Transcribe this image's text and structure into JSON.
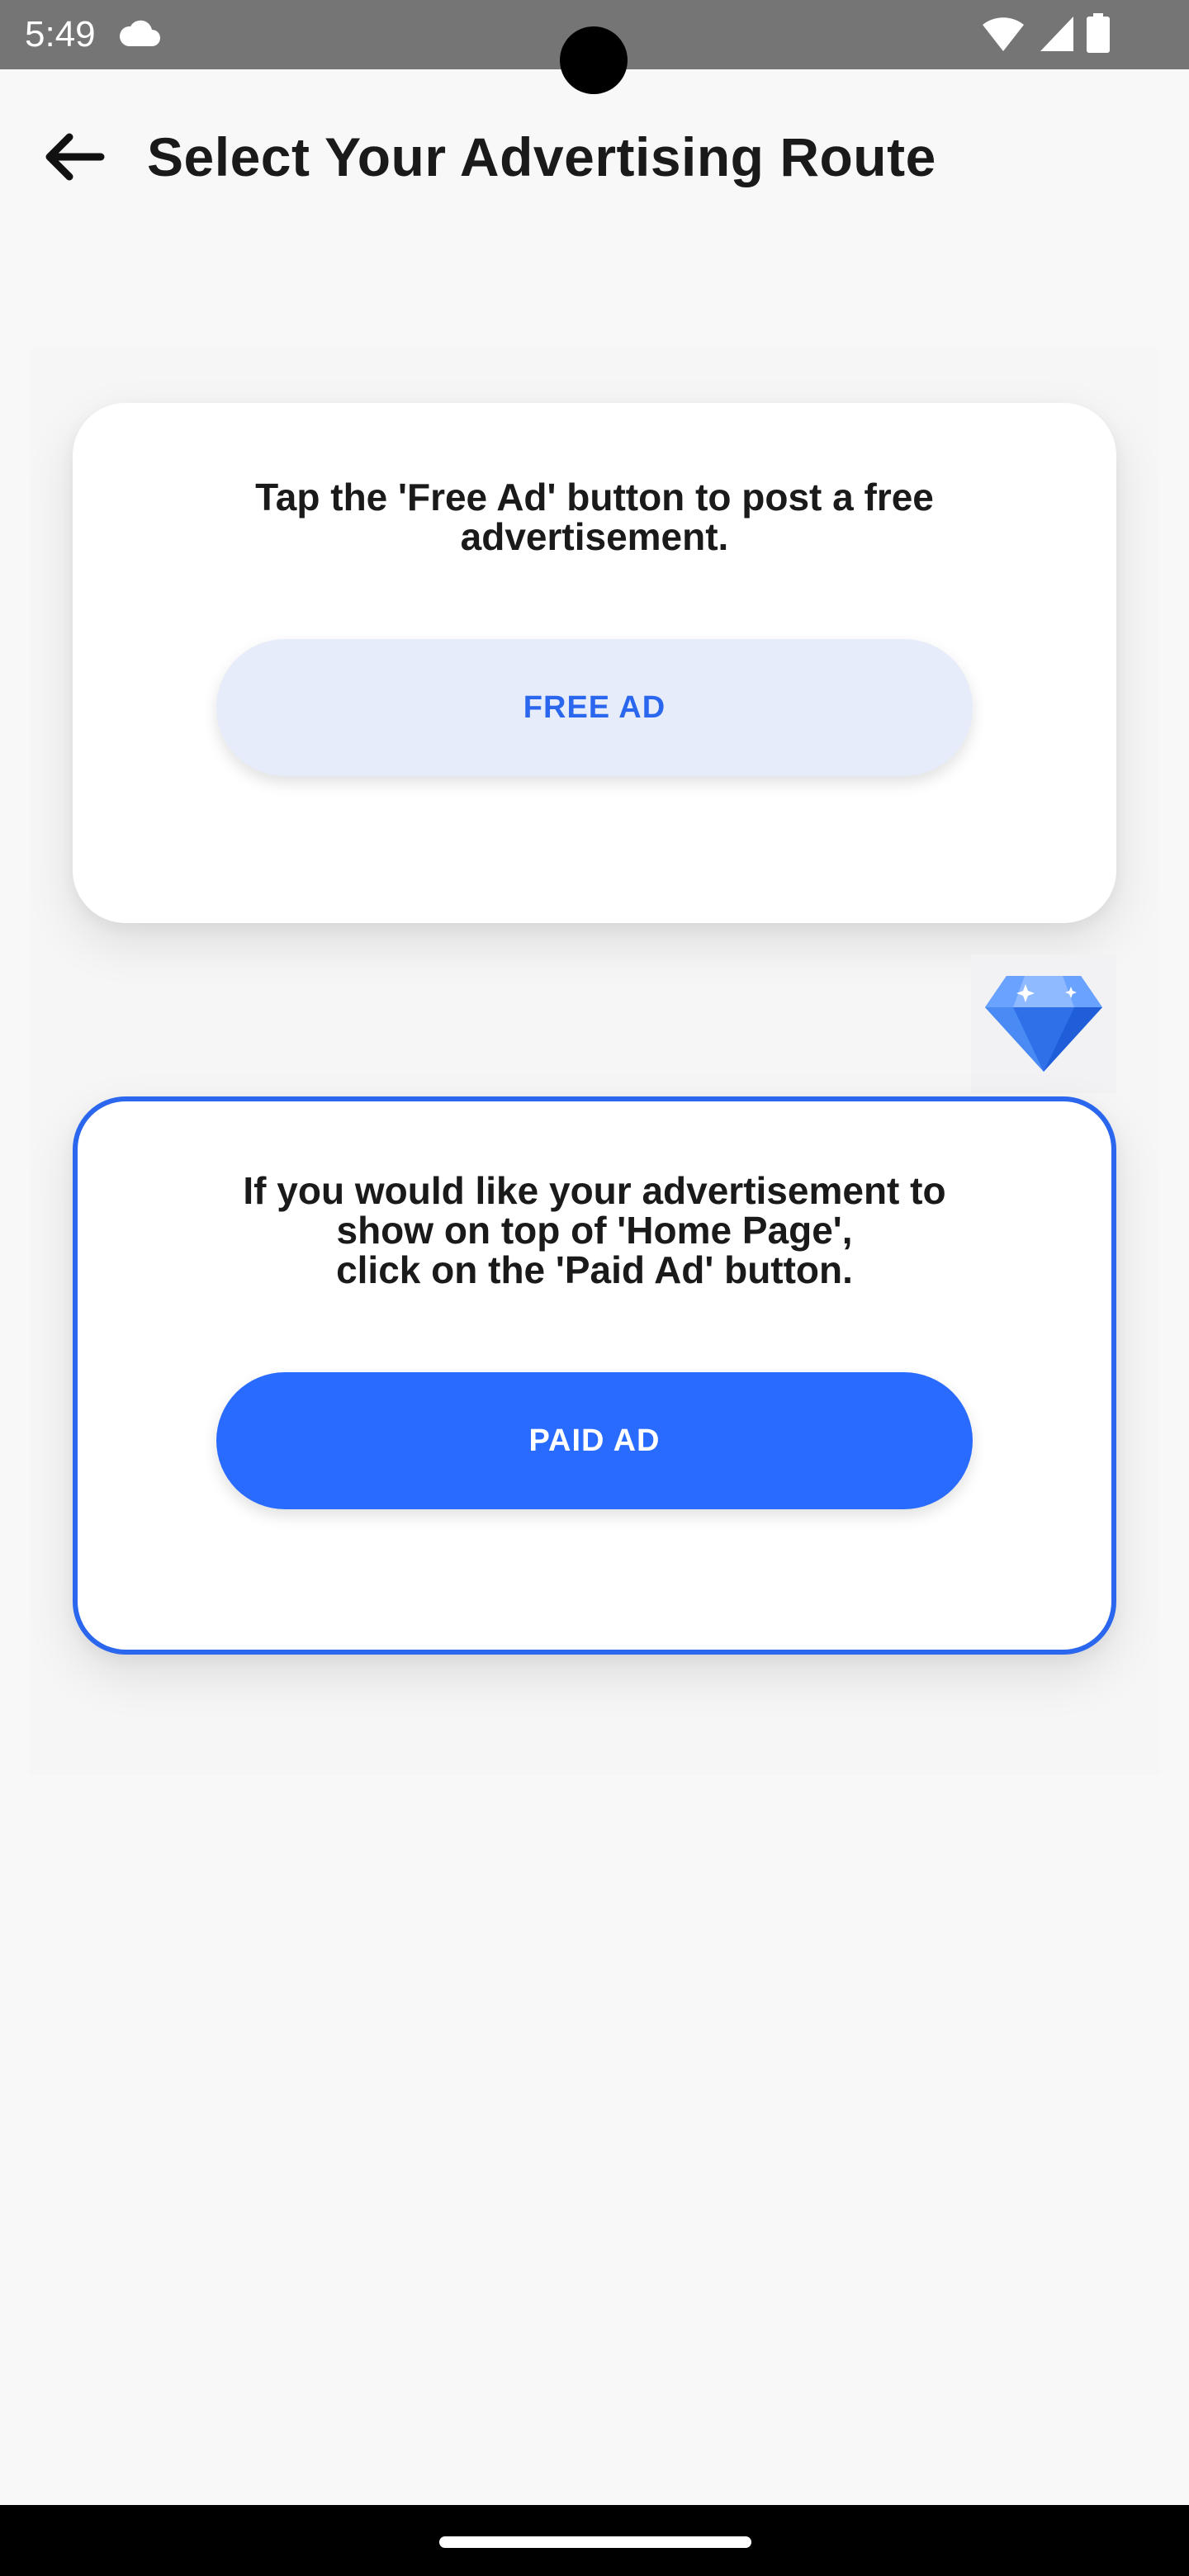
{
  "status_bar": {
    "time": "5:49",
    "icons": [
      "cloud-icon",
      "wifi-icon",
      "signal-icon",
      "battery-icon"
    ]
  },
  "app_bar": {
    "back_icon": "arrow-left-icon",
    "title": "Select Your Advertising Route"
  },
  "free_card": {
    "description": "Tap the 'Free Ad' button to post a free\nadvertisement.",
    "button_label": "FREE AD"
  },
  "premium_badge": {
    "icon": "diamond-icon"
  },
  "paid_card": {
    "description": "If you would like your advertisement to\nshow on top of 'Home Page',\nclick on the 'Paid Ad' button.",
    "button_label": "PAID AD"
  },
  "colors": {
    "accent": "#2a67ee",
    "paid_button": "#2a6bff",
    "free_button_bg": "#e6ecfa",
    "status_bar": "#757575",
    "background": "#f8f8f8"
  }
}
